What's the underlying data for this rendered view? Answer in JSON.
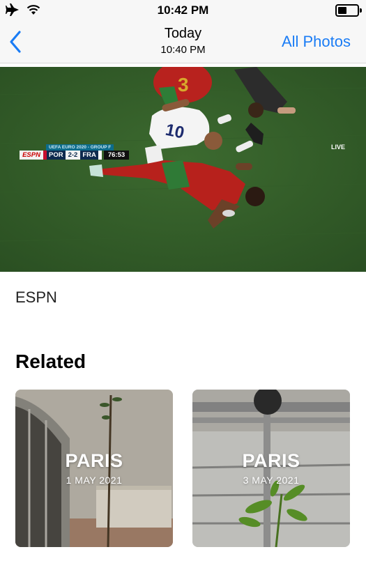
{
  "status_bar": {
    "time": "10:42 PM",
    "icons": [
      "airplane-icon",
      "wifi-icon",
      "battery-icon"
    ],
    "battery_level": 0.55
  },
  "nav": {
    "back_icon": "chevron-left-icon",
    "title": "Today",
    "subtitle": "10:40 PM",
    "all_photos_label": "All Photos",
    "accent_color": "#1a7cf5"
  },
  "photo": {
    "scorebug": {
      "competition": "UEFA EURO 2020 - GROUP F",
      "network": "ESPN",
      "home_team": "POR",
      "score": "2-2",
      "away_team": "FRA",
      "clock": "76:53"
    },
    "live_label": "LIVE"
  },
  "caption": "ESPN",
  "related": {
    "heading": "Related",
    "cards": [
      {
        "title": "PARIS",
        "date": "1 MAY 2021"
      },
      {
        "title": "PARIS",
        "date": "3 MAY 2021"
      }
    ]
  }
}
